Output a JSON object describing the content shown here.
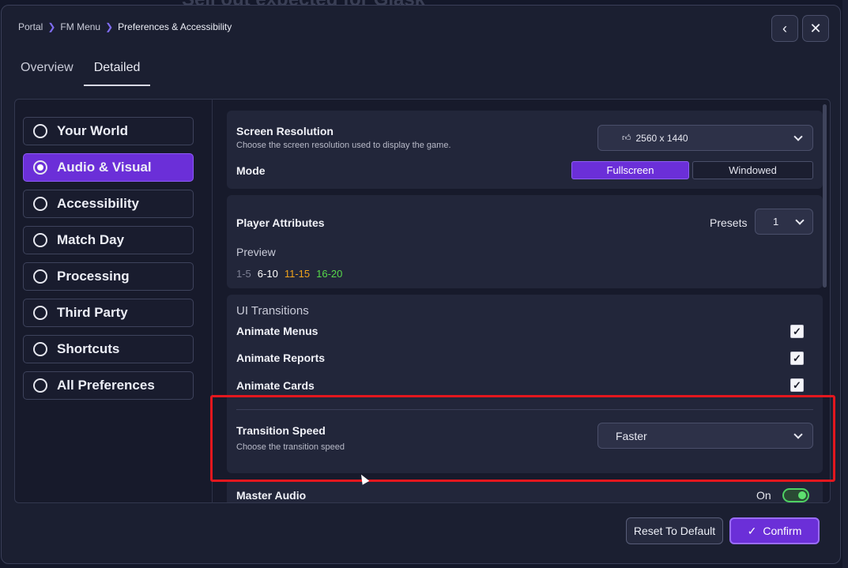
{
  "background": {
    "title": "Sell out expected for Glask"
  },
  "breadcrumb": [
    "Portal",
    "FM Menu",
    "Preferences & Accessibility"
  ],
  "header_buttons": {
    "back_icon": "chevron-left-icon",
    "close_icon": "close-icon"
  },
  "tabs": [
    {
      "label": "Overview",
      "active": false
    },
    {
      "label": "Detailed",
      "active": true
    }
  ],
  "nav": [
    {
      "label": "Your World",
      "active": false
    },
    {
      "label": "Audio & Visual",
      "active": true
    },
    {
      "label": "Accessibility",
      "active": false
    },
    {
      "label": "Match Day",
      "active": false
    },
    {
      "label": "Processing",
      "active": false
    },
    {
      "label": "Third Party",
      "active": false
    },
    {
      "label": "Shortcuts",
      "active": false
    },
    {
      "label": "All Preferences",
      "active": false
    }
  ],
  "screen": {
    "title": "Screen Resolution",
    "subtitle": "Choose the screen resolution used to display the game.",
    "resolution_value": "2560 x 1440",
    "resolution_icon": "thumbs-up-icon",
    "mode_label": "Mode",
    "mode_options": [
      "Fullscreen",
      "Windowed"
    ],
    "mode_selected": "Fullscreen"
  },
  "player_attributes": {
    "title": "Player Attributes",
    "presets_label": "Presets",
    "presets_value": "1",
    "preview_label": "Preview",
    "ranges": [
      {
        "label": "1-5",
        "color": "#7d8094"
      },
      {
        "label": "6-10",
        "color": "#ffffff"
      },
      {
        "label": "11-15",
        "color": "#f0a31c"
      },
      {
        "label": "16-20",
        "color": "#57d84a"
      }
    ]
  },
  "ui_transitions": {
    "heading": "UI Transitions",
    "items": [
      {
        "label": "Animate Menus",
        "checked": true
      },
      {
        "label": "Animate Reports",
        "checked": true
      },
      {
        "label": "Animate Cards",
        "checked": true
      }
    ],
    "speed_title": "Transition Speed",
    "speed_subtitle": "Choose the transition speed",
    "speed_value": "Faster"
  },
  "master_audio": {
    "label": "Master Audio",
    "state_label": "On",
    "on": true
  },
  "footer": {
    "reset_label": "Reset To Default",
    "confirm_label": "Confirm"
  },
  "colors": {
    "accent": "#6b2fd8",
    "highlight": "#e3171e",
    "toggle_on": "#4fd163"
  }
}
